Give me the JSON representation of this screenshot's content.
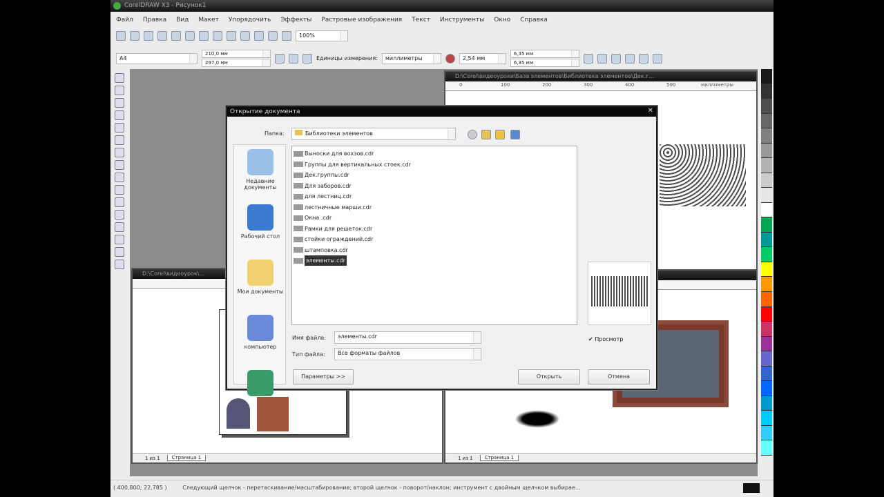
{
  "app": {
    "title": "CorelDRAW X3 - Рисунок1"
  },
  "menu": [
    "Файл",
    "Правка",
    "Вид",
    "Макет",
    "Упорядочить",
    "Эффекты",
    "Растровые изображения",
    "Текст",
    "Инструменты",
    "Окно",
    "Справка"
  ],
  "toolbar": {
    "zoom": "100%"
  },
  "propbar": {
    "page_size": "A4",
    "width": "210,0 мм",
    "height": "297,0 мм",
    "units_label": "Единицы измерения:",
    "units": "миллиметры",
    "nudge": "2,54 мм",
    "dup_x": "6,35 мм",
    "dup_y": "6,35 мм"
  },
  "doc_windows": [
    {
      "title": "D:\\Corel\\видеоуроки\\База элементов\\Библиотека элементов\\Дек.г...",
      "ruler": [
        "0",
        "100",
        "200",
        "300",
        "400",
        "500",
        "миллиметры"
      ]
    },
    {
      "title": "D:\\Corel\\видеоурок\\...",
      "pager": "1 из 1",
      "tab": "Страница 1"
    },
    {
      "title": "",
      "pager": "1 из 1",
      "tab": "Страница 1"
    }
  ],
  "dialog": {
    "title": "Открытие документа",
    "folder_label": "Папка:",
    "folder": "Библиотеки элементов",
    "places": [
      "Недавние документы",
      "Рабочий стол",
      "Мои документы",
      "компьютер"
    ],
    "files": [
      "Выноски для вохзов.cdr",
      "Группы для вертикальных стоек.cdr",
      "Дек.группы.cdr",
      "Для заборов.cdr",
      "для лестниц.cdr",
      "лестничные марши.cdr",
      "Окна .cdr",
      "Рамки для решеток.cdr",
      "стойки ограждений.cdr",
      "штамповка.cdr",
      "элементы.cdr"
    ],
    "selected_index": 10,
    "filename_label": "Имя файла:",
    "filename": "элементы.cdr",
    "filetype_label": "Тип файла:",
    "filetype": "Все форматы файлов",
    "preview_label": "Просмотр",
    "preview_checked": true,
    "params_button": "Параметры >>",
    "open_button": "Открыть",
    "cancel_button": "Отмена"
  },
  "status": {
    "coords": "( 400,800; 22,785 )",
    "hint": "Следующий щелчок - перетаскивание/масштабирование; второй щелчок - поворот/наклон; инструмент с двойным щелчком выбирае..."
  },
  "palette": [
    "#1a1a1a",
    "#333333",
    "#4d4d4d",
    "#666666",
    "#808080",
    "#999999",
    "#b3b3b3",
    "#cccccc",
    "#e6e6e6",
    "#ffffff",
    "#00a651",
    "#009999",
    "#00cc66",
    "#ffff00",
    "#ff9900",
    "#ff6600",
    "#ff0000",
    "#cc3366",
    "#993399",
    "#6666cc",
    "#3366cc",
    "#0066ff",
    "#0099cc",
    "#00ccff",
    "#33ccff",
    "#66ffff"
  ]
}
